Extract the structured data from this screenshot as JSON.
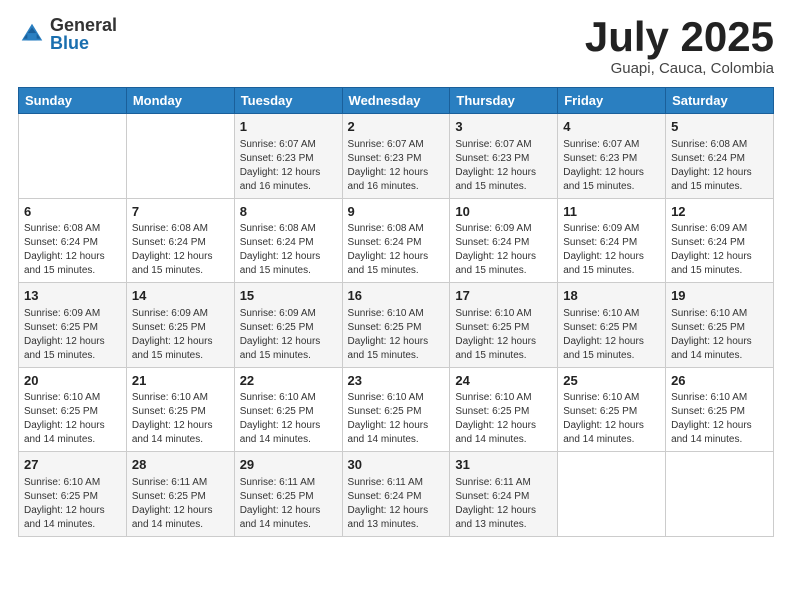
{
  "header": {
    "logo_general": "General",
    "logo_blue": "Blue",
    "month_title": "July 2025",
    "location": "Guapi, Cauca, Colombia"
  },
  "weekdays": [
    "Sunday",
    "Monday",
    "Tuesday",
    "Wednesday",
    "Thursday",
    "Friday",
    "Saturday"
  ],
  "weeks": [
    [
      {
        "day": "",
        "sunrise": "",
        "sunset": "",
        "daylight": ""
      },
      {
        "day": "",
        "sunrise": "",
        "sunset": "",
        "daylight": ""
      },
      {
        "day": "1",
        "sunrise": "Sunrise: 6:07 AM",
        "sunset": "Sunset: 6:23 PM",
        "daylight": "Daylight: 12 hours and 16 minutes."
      },
      {
        "day": "2",
        "sunrise": "Sunrise: 6:07 AM",
        "sunset": "Sunset: 6:23 PM",
        "daylight": "Daylight: 12 hours and 16 minutes."
      },
      {
        "day": "3",
        "sunrise": "Sunrise: 6:07 AM",
        "sunset": "Sunset: 6:23 PM",
        "daylight": "Daylight: 12 hours and 15 minutes."
      },
      {
        "day": "4",
        "sunrise": "Sunrise: 6:07 AM",
        "sunset": "Sunset: 6:23 PM",
        "daylight": "Daylight: 12 hours and 15 minutes."
      },
      {
        "day": "5",
        "sunrise": "Sunrise: 6:08 AM",
        "sunset": "Sunset: 6:24 PM",
        "daylight": "Daylight: 12 hours and 15 minutes."
      }
    ],
    [
      {
        "day": "6",
        "sunrise": "Sunrise: 6:08 AM",
        "sunset": "Sunset: 6:24 PM",
        "daylight": "Daylight: 12 hours and 15 minutes."
      },
      {
        "day": "7",
        "sunrise": "Sunrise: 6:08 AM",
        "sunset": "Sunset: 6:24 PM",
        "daylight": "Daylight: 12 hours and 15 minutes."
      },
      {
        "day": "8",
        "sunrise": "Sunrise: 6:08 AM",
        "sunset": "Sunset: 6:24 PM",
        "daylight": "Daylight: 12 hours and 15 minutes."
      },
      {
        "day": "9",
        "sunrise": "Sunrise: 6:08 AM",
        "sunset": "Sunset: 6:24 PM",
        "daylight": "Daylight: 12 hours and 15 minutes."
      },
      {
        "day": "10",
        "sunrise": "Sunrise: 6:09 AM",
        "sunset": "Sunset: 6:24 PM",
        "daylight": "Daylight: 12 hours and 15 minutes."
      },
      {
        "day": "11",
        "sunrise": "Sunrise: 6:09 AM",
        "sunset": "Sunset: 6:24 PM",
        "daylight": "Daylight: 12 hours and 15 minutes."
      },
      {
        "day": "12",
        "sunrise": "Sunrise: 6:09 AM",
        "sunset": "Sunset: 6:24 PM",
        "daylight": "Daylight: 12 hours and 15 minutes."
      }
    ],
    [
      {
        "day": "13",
        "sunrise": "Sunrise: 6:09 AM",
        "sunset": "Sunset: 6:25 PM",
        "daylight": "Daylight: 12 hours and 15 minutes."
      },
      {
        "day": "14",
        "sunrise": "Sunrise: 6:09 AM",
        "sunset": "Sunset: 6:25 PM",
        "daylight": "Daylight: 12 hours and 15 minutes."
      },
      {
        "day": "15",
        "sunrise": "Sunrise: 6:09 AM",
        "sunset": "Sunset: 6:25 PM",
        "daylight": "Daylight: 12 hours and 15 minutes."
      },
      {
        "day": "16",
        "sunrise": "Sunrise: 6:10 AM",
        "sunset": "Sunset: 6:25 PM",
        "daylight": "Daylight: 12 hours and 15 minutes."
      },
      {
        "day": "17",
        "sunrise": "Sunrise: 6:10 AM",
        "sunset": "Sunset: 6:25 PM",
        "daylight": "Daylight: 12 hours and 15 minutes."
      },
      {
        "day": "18",
        "sunrise": "Sunrise: 6:10 AM",
        "sunset": "Sunset: 6:25 PM",
        "daylight": "Daylight: 12 hours and 15 minutes."
      },
      {
        "day": "19",
        "sunrise": "Sunrise: 6:10 AM",
        "sunset": "Sunset: 6:25 PM",
        "daylight": "Daylight: 12 hours and 14 minutes."
      }
    ],
    [
      {
        "day": "20",
        "sunrise": "Sunrise: 6:10 AM",
        "sunset": "Sunset: 6:25 PM",
        "daylight": "Daylight: 12 hours and 14 minutes."
      },
      {
        "day": "21",
        "sunrise": "Sunrise: 6:10 AM",
        "sunset": "Sunset: 6:25 PM",
        "daylight": "Daylight: 12 hours and 14 minutes."
      },
      {
        "day": "22",
        "sunrise": "Sunrise: 6:10 AM",
        "sunset": "Sunset: 6:25 PM",
        "daylight": "Daylight: 12 hours and 14 minutes."
      },
      {
        "day": "23",
        "sunrise": "Sunrise: 6:10 AM",
        "sunset": "Sunset: 6:25 PM",
        "daylight": "Daylight: 12 hours and 14 minutes."
      },
      {
        "day": "24",
        "sunrise": "Sunrise: 6:10 AM",
        "sunset": "Sunset: 6:25 PM",
        "daylight": "Daylight: 12 hours and 14 minutes."
      },
      {
        "day": "25",
        "sunrise": "Sunrise: 6:10 AM",
        "sunset": "Sunset: 6:25 PM",
        "daylight": "Daylight: 12 hours and 14 minutes."
      },
      {
        "day": "26",
        "sunrise": "Sunrise: 6:10 AM",
        "sunset": "Sunset: 6:25 PM",
        "daylight": "Daylight: 12 hours and 14 minutes."
      }
    ],
    [
      {
        "day": "27",
        "sunrise": "Sunrise: 6:10 AM",
        "sunset": "Sunset: 6:25 PM",
        "daylight": "Daylight: 12 hours and 14 minutes."
      },
      {
        "day": "28",
        "sunrise": "Sunrise: 6:11 AM",
        "sunset": "Sunset: 6:25 PM",
        "daylight": "Daylight: 12 hours and 14 minutes."
      },
      {
        "day": "29",
        "sunrise": "Sunrise: 6:11 AM",
        "sunset": "Sunset: 6:25 PM",
        "daylight": "Daylight: 12 hours and 14 minutes."
      },
      {
        "day": "30",
        "sunrise": "Sunrise: 6:11 AM",
        "sunset": "Sunset: 6:24 PM",
        "daylight": "Daylight: 12 hours and 13 minutes."
      },
      {
        "day": "31",
        "sunrise": "Sunrise: 6:11 AM",
        "sunset": "Sunset: 6:24 PM",
        "daylight": "Daylight: 12 hours and 13 minutes."
      },
      {
        "day": "",
        "sunrise": "",
        "sunset": "",
        "daylight": ""
      },
      {
        "day": "",
        "sunrise": "",
        "sunset": "",
        "daylight": ""
      }
    ]
  ]
}
